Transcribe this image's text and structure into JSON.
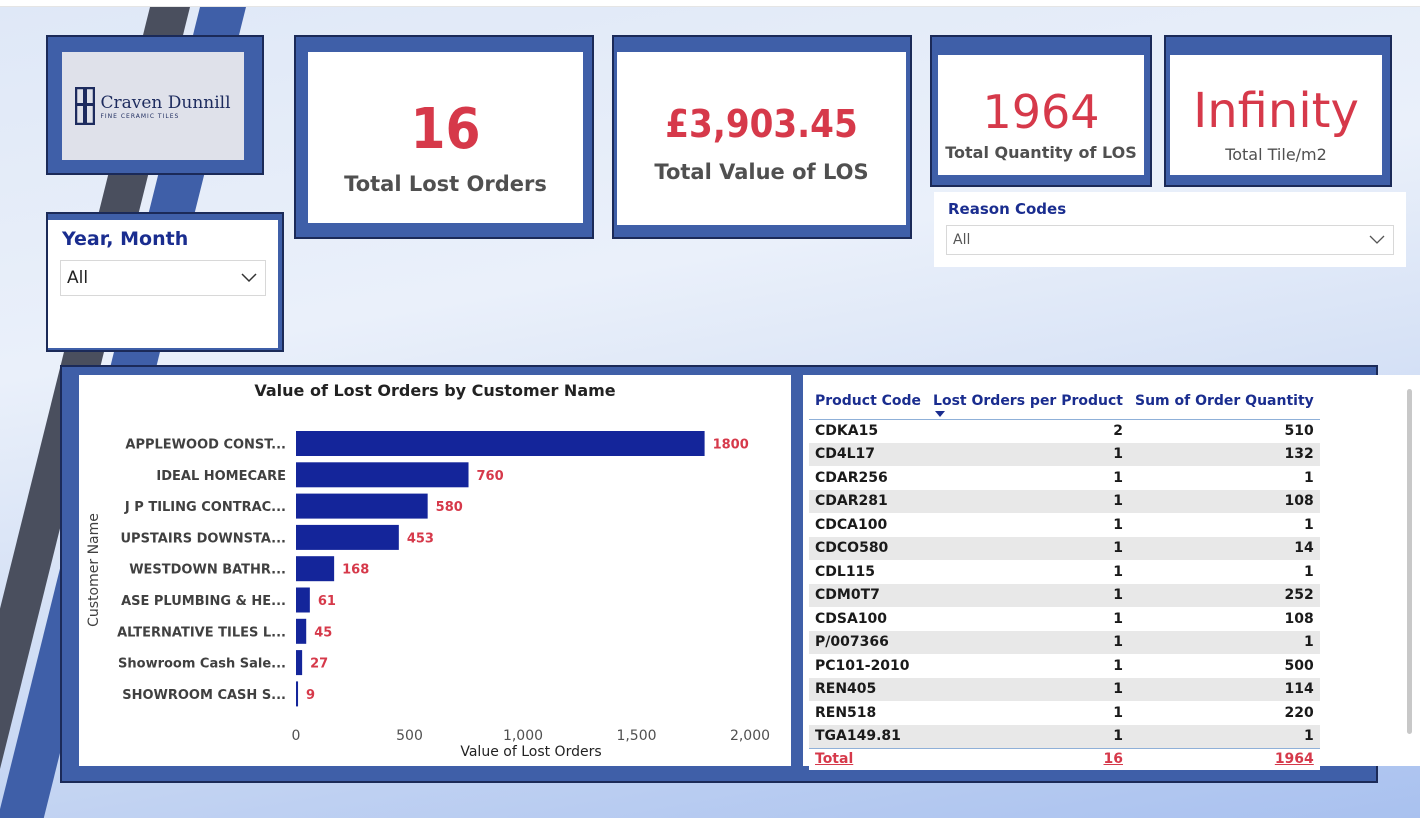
{
  "brand": {
    "logo_name": "Craven Dunnill",
    "logo_tagline": "FINE CERAMIC TILES"
  },
  "kpis": {
    "total_lost_orders": {
      "value": "16",
      "label": "Total Lost Orders"
    },
    "total_value_los": {
      "value": "£3,903.45",
      "label": "Total Value of LOS"
    },
    "total_quantity_los": {
      "value": "1964",
      "label": "Total Quantity of LOS"
    },
    "total_tile_m2": {
      "value": "Infinity",
      "label": "Total Tile/m2"
    }
  },
  "slicers": {
    "year_month": {
      "title": "Year, Month",
      "value": "All"
    },
    "reason_codes": {
      "title": "Reason Codes",
      "value": "All"
    }
  },
  "colors": {
    "accent_red": "#d6394a",
    "bar_blue": "#14259a",
    "frame_blue": "#3f5fa8",
    "header_blue": "#1a2d8f"
  },
  "chart_data": {
    "type": "bar",
    "orientation": "horizontal",
    "title": "Value of Lost Orders by Customer Name",
    "xlabel": "Value of Lost Orders",
    "ylabel": "Customer Name",
    "categories": [
      "APPLEWOOD CONST...",
      "IDEAL HOMECARE",
      "J P TILING CONTRAC...",
      "UPSTAIRS DOWNSTA...",
      "WESTDOWN BATHR...",
      "ASE PLUMBING & HE...",
      "ALTERNATIVE TILES L...",
      "Showroom Cash Sale...",
      "SHOWROOM CASH S..."
    ],
    "values": [
      1800,
      760,
      580,
      453,
      168,
      61,
      45,
      27,
      9
    ],
    "xlim": [
      0,
      2000
    ],
    "xticks": [
      "0",
      "500",
      "1,000",
      "1,500",
      "2,000"
    ],
    "xtick_values": [
      0,
      500,
      1000,
      1500,
      2000
    ],
    "data_labels": true,
    "grid": false
  },
  "table": {
    "columns": [
      "Product Code",
      "Lost Orders per Product",
      "Sum of Order Quantity"
    ],
    "sort_icon": "sort-descending-icon",
    "rows": [
      [
        "CDKA15",
        "2",
        "510"
      ],
      [
        "CD4L17",
        "1",
        "132"
      ],
      [
        "CDAR256",
        "1",
        "1"
      ],
      [
        "CDAR281",
        "1",
        "108"
      ],
      [
        "CDCA100",
        "1",
        "1"
      ],
      [
        "CDCO580",
        "1",
        "14"
      ],
      [
        "CDL115",
        "1",
        "1"
      ],
      [
        "CDM0T7",
        "1",
        "252"
      ],
      [
        "CDSA100",
        "1",
        "108"
      ],
      [
        "P/007366",
        "1",
        "1"
      ],
      [
        "PC101-2010",
        "1",
        "500"
      ],
      [
        "REN405",
        "1",
        "114"
      ],
      [
        "REN518",
        "1",
        "220"
      ],
      [
        "TGA149.81",
        "1",
        "1"
      ]
    ],
    "total": [
      "Total",
      "16",
      "1964"
    ]
  }
}
